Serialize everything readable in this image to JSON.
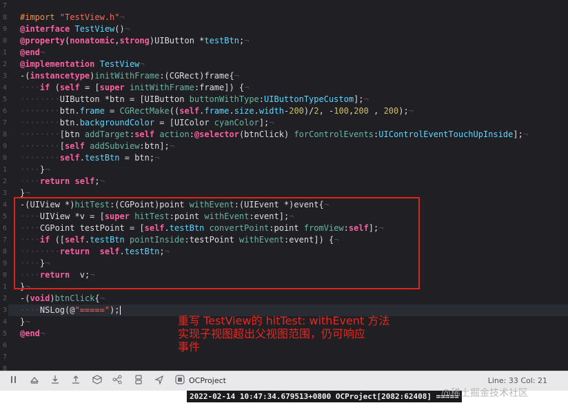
{
  "editor": {
    "line_numbers": [
      "7",
      "8",
      "9",
      "0",
      "1",
      "2",
      "3",
      "4",
      "5",
      "6",
      "7",
      "8",
      "9",
      "0",
      "1",
      "2",
      "3",
      "4",
      "5",
      "6",
      "7",
      "8",
      "9",
      "0",
      "1",
      "2",
      "3",
      "4",
      "5",
      "6",
      "7",
      "8",
      "3",
      "4",
      "5",
      "6"
    ],
    "code": [
      {
        "t": "",
        "ws": ""
      },
      {
        "segs": [
          [
            "pp",
            "#import "
          ],
          [
            "str",
            "\"TestView.h\""
          ],
          [
            "ws",
            "¬"
          ]
        ]
      },
      {
        "segs": [
          [
            "kw",
            "@interface"
          ],
          [
            "pl",
            " "
          ],
          [
            "ty",
            "TestView"
          ],
          [
            "pl",
            "()"
          ],
          [
            "ws",
            "¬"
          ]
        ]
      },
      {
        "segs": [
          [
            "kw",
            "@property"
          ],
          [
            "pl",
            "("
          ],
          [
            "kw",
            "nonatomic"
          ],
          [
            "pl",
            ","
          ],
          [
            "kw",
            "strong"
          ],
          [
            "pl",
            ")UIButton "
          ],
          [
            "pl",
            "*"
          ],
          [
            "ty",
            "testBtn"
          ],
          [
            "pl",
            ";"
          ],
          [
            "ws",
            "¬"
          ]
        ]
      },
      {
        "segs": [
          [
            "kw",
            "@end"
          ],
          [
            "ws",
            "¬"
          ]
        ]
      },
      {
        "segs": [
          [
            "kw",
            "@implementation"
          ],
          [
            "pl",
            " "
          ],
          [
            "ty",
            "TestView"
          ],
          [
            "ws",
            "¬"
          ]
        ]
      },
      {
        "segs": [
          [
            "pl",
            "-("
          ],
          [
            "kw",
            "instancetype"
          ],
          [
            "pl",
            ")"
          ],
          [
            "fn",
            "initWithFrame"
          ],
          [
            "pl",
            ":(CGRect)frame{"
          ],
          [
            "ws",
            "¬"
          ]
        ]
      },
      {
        "segs": [
          [
            "ws",
            "····"
          ],
          [
            "kw",
            "if"
          ],
          [
            "pl",
            " ("
          ],
          [
            "kw",
            "self"
          ],
          [
            "pl",
            " = ["
          ],
          [
            "kw",
            "super"
          ],
          [
            "pl",
            " "
          ],
          [
            "fn",
            "initWithFrame"
          ],
          [
            "pl",
            ":frame]) {"
          ],
          [
            "ws",
            "¬"
          ]
        ]
      },
      {
        "segs": [
          [
            "ws",
            "········"
          ],
          [
            "pl",
            "UIButton *btn = [UIButton "
          ],
          [
            "fn",
            "buttonWithType"
          ],
          [
            "pl",
            ":"
          ],
          [
            "ty",
            "UIButtonTypeCustom"
          ],
          [
            "pl",
            "];"
          ],
          [
            "ws",
            "¬"
          ]
        ]
      },
      {
        "segs": [
          [
            "ws",
            "········"
          ],
          [
            "pl",
            "btn."
          ],
          [
            "ty",
            "frame"
          ],
          [
            "pl",
            " = "
          ],
          [
            "fn",
            "CGRectMake"
          ],
          [
            "pl",
            "(("
          ],
          [
            "kw",
            "self"
          ],
          [
            "pl",
            "."
          ],
          [
            "ty",
            "frame"
          ],
          [
            "pl",
            "."
          ],
          [
            "ty",
            "size"
          ],
          [
            "pl",
            "."
          ],
          [
            "ty",
            "width"
          ],
          [
            "pl",
            "-"
          ],
          [
            "num",
            "200"
          ],
          [
            "pl",
            ")/"
          ],
          [
            "num",
            "2"
          ],
          [
            "pl",
            ", -"
          ],
          [
            "num",
            "100"
          ],
          [
            "pl",
            ","
          ],
          [
            "num",
            "200"
          ],
          [
            "pl",
            " , "
          ],
          [
            "num",
            "200"
          ],
          [
            "pl",
            ");"
          ],
          [
            "ws",
            "¬"
          ]
        ]
      },
      {
        "segs": [
          [
            "ws",
            "········"
          ],
          [
            "pl",
            "btn."
          ],
          [
            "ty",
            "backgroundColor"
          ],
          [
            "pl",
            " = [UIColor "
          ],
          [
            "fn",
            "cyanColor"
          ],
          [
            "pl",
            "];"
          ],
          [
            "ws",
            "¬"
          ]
        ]
      },
      {
        "segs": [
          [
            "ws",
            "········"
          ],
          [
            "pl",
            "[btn "
          ],
          [
            "fn",
            "addTarget"
          ],
          [
            "pl",
            ":"
          ],
          [
            "kw",
            "self"
          ],
          [
            "pl",
            " "
          ],
          [
            "fn",
            "action"
          ],
          [
            "pl",
            ":"
          ],
          [
            "kw",
            "@selector"
          ],
          [
            "pl",
            "(btnClick) "
          ],
          [
            "fn",
            "forControlEvents"
          ],
          [
            "pl",
            ":"
          ],
          [
            "ty",
            "UIControlEventTouchUpInside"
          ],
          [
            "pl",
            "];"
          ],
          [
            "ws",
            "¬"
          ]
        ]
      },
      {
        "segs": [
          [
            "ws",
            "········"
          ],
          [
            "pl",
            "["
          ],
          [
            "kw",
            "self"
          ],
          [
            "pl",
            " "
          ],
          [
            "fn",
            "addSubview"
          ],
          [
            "pl",
            ":btn];"
          ],
          [
            "ws",
            "¬"
          ]
        ]
      },
      {
        "segs": [
          [
            "ws",
            "········"
          ],
          [
            "kw",
            "self"
          ],
          [
            "pl",
            "."
          ],
          [
            "ty",
            "testBtn"
          ],
          [
            "pl",
            " = btn;"
          ],
          [
            "ws",
            "¬"
          ]
        ]
      },
      {
        "segs": [
          [
            "ws",
            "····"
          ],
          [
            "pl",
            "}"
          ],
          [
            "ws",
            "¬"
          ]
        ]
      },
      {
        "segs": [
          [
            "ws",
            "····"
          ],
          [
            "kw",
            "return"
          ],
          [
            "pl",
            " "
          ],
          [
            "kw",
            "self"
          ],
          [
            "pl",
            ";"
          ],
          [
            "ws",
            "¬"
          ]
        ]
      },
      {
        "segs": [
          [
            "pl",
            "}"
          ],
          [
            "ws",
            "¬"
          ]
        ]
      },
      {
        "segs": [
          [
            "pl",
            "-(UIView *)"
          ],
          [
            "fn",
            "hitTest"
          ],
          [
            "pl",
            ":(CGPoint)point "
          ],
          [
            "fn",
            "withEvent"
          ],
          [
            "pl",
            ":(UIEvent *)event{"
          ],
          [
            "ws",
            "¬"
          ]
        ]
      },
      {
        "segs": [
          [
            "ws",
            "····"
          ],
          [
            "pl",
            "UIView *v = ["
          ],
          [
            "kw",
            "super"
          ],
          [
            "pl",
            " "
          ],
          [
            "fn",
            "hitTest"
          ],
          [
            "pl",
            ":point "
          ],
          [
            "fn",
            "withEvent"
          ],
          [
            "pl",
            ":event];"
          ],
          [
            "ws",
            "¬"
          ]
        ]
      },
      {
        "segs": [
          [
            "ws",
            "····"
          ],
          [
            "pl",
            "CGPoint testPoint = ["
          ],
          [
            "kw",
            "self"
          ],
          [
            "pl",
            "."
          ],
          [
            "ty",
            "testBtn"
          ],
          [
            "pl",
            " "
          ],
          [
            "fn",
            "convertPoint"
          ],
          [
            "pl",
            ":point "
          ],
          [
            "fn",
            "fromView"
          ],
          [
            "pl",
            ":"
          ],
          [
            "kw",
            "self"
          ],
          [
            "pl",
            "];"
          ],
          [
            "ws",
            "¬"
          ]
        ]
      },
      {
        "segs": [
          [
            "ws",
            "····"
          ],
          [
            "kw",
            "if"
          ],
          [
            "pl",
            " (["
          ],
          [
            "kw",
            "self"
          ],
          [
            "pl",
            "."
          ],
          [
            "ty",
            "testBtn"
          ],
          [
            "pl",
            " "
          ],
          [
            "fn",
            "pointInside"
          ],
          [
            "pl",
            ":testPoint "
          ],
          [
            "fn",
            "withEvent"
          ],
          [
            "pl",
            ":event]) {"
          ],
          [
            "ws",
            "¬"
          ]
        ]
      },
      {
        "segs": [
          [
            "ws",
            "········"
          ],
          [
            "kw",
            "return"
          ],
          [
            "pl",
            "  "
          ],
          [
            "kw",
            "self"
          ],
          [
            "pl",
            "."
          ],
          [
            "ty",
            "testBtn"
          ],
          [
            "pl",
            ";"
          ],
          [
            "ws",
            "¬"
          ]
        ]
      },
      {
        "segs": [
          [
            "ws",
            "····"
          ],
          [
            "pl",
            "}"
          ],
          [
            "ws",
            "¬"
          ]
        ]
      },
      {
        "segs": [
          [
            "ws",
            "····"
          ],
          [
            "kw",
            "return"
          ],
          [
            "pl",
            "  v;"
          ],
          [
            "ws",
            "¬"
          ]
        ]
      },
      {
        "segs": [
          [
            "pl",
            "}"
          ],
          [
            "ws",
            "¬"
          ]
        ]
      },
      {
        "segs": [
          [
            "pl",
            "-("
          ],
          [
            "kw",
            "void"
          ],
          [
            "pl",
            ")"
          ],
          [
            "fn",
            "btnClick"
          ],
          [
            "pl",
            "{"
          ],
          [
            "ws",
            "¬"
          ]
        ]
      },
      {
        "cur": true,
        "segs": [
          [
            "ws",
            "····"
          ],
          [
            "pl",
            "NSLog(@"
          ],
          [
            "str",
            "\"=====\""
          ],
          [
            "pl",
            ");"
          ]
        ]
      },
      {
        "segs": [
          [
            "pl",
            "}"
          ],
          [
            "ws",
            "¬"
          ]
        ]
      },
      {
        "segs": [
          [
            "kw",
            "@end"
          ],
          [
            "ws",
            "¬"
          ]
        ]
      }
    ]
  },
  "annotation": {
    "line1": "重写 TestView的 hitTest: withEvent 方法",
    "line2": "实现子视图超出父视图范围，仍可响应",
    "line3": "事件"
  },
  "statusbar": {
    "scheme": "OCProject",
    "position": "Line: 33  Col: 21",
    "icons": [
      "pause-icon",
      "step-over-icon",
      "step-in-icon",
      "step-out-icon",
      "view-hierarchy-icon",
      "memory-graph-icon",
      "environment-icon",
      "location-icon",
      "scheme-icon"
    ]
  },
  "console": {
    "text": "2022-02-14 10:47:34.679513+0800 OCProject[2082:62408] ====="
  },
  "watermark": "@稀土掘金技术社区",
  "colors": {
    "highlight_border": "#e0231b",
    "annotation": "#e8271f"
  }
}
